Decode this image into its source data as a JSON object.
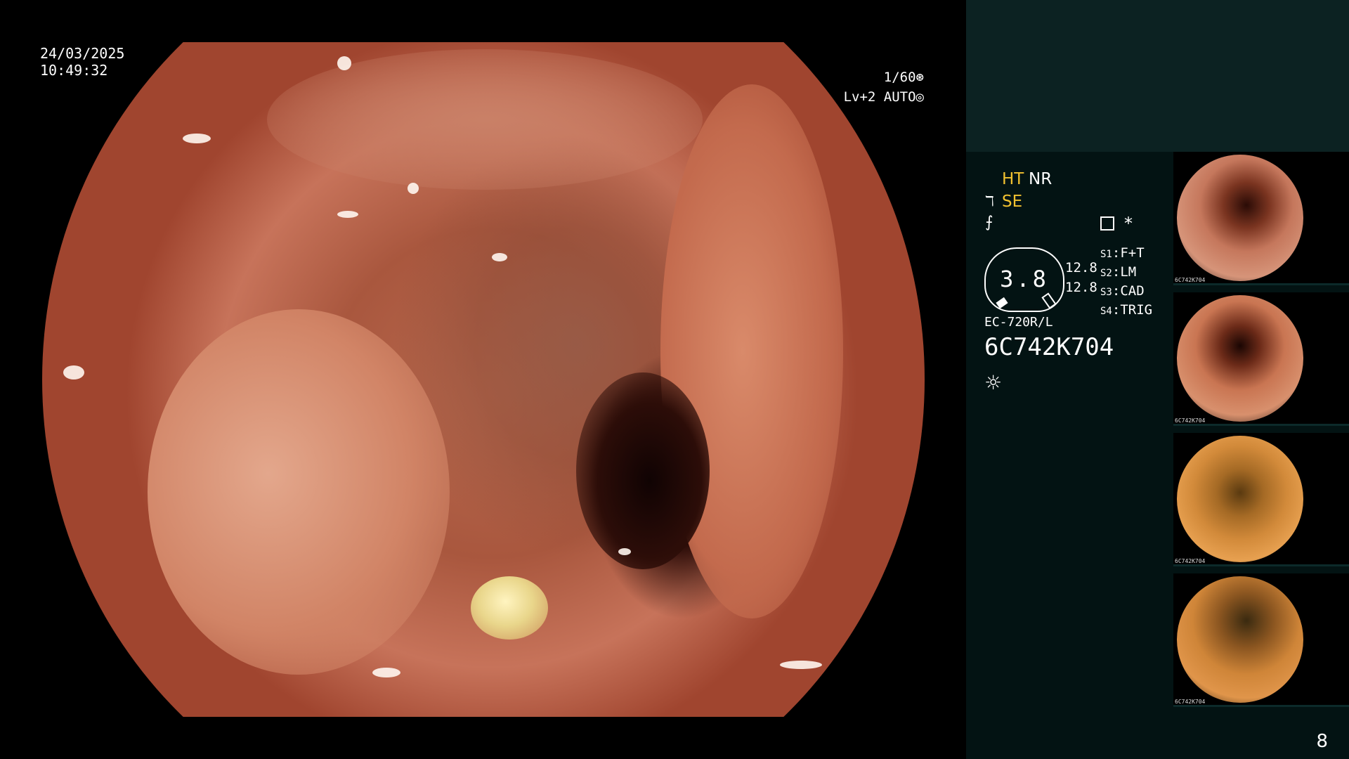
{
  "overlay": {
    "date": "24/03/2025",
    "time": "10:49:32",
    "shutter": "1/60",
    "shutter_icon": "aperture-icon",
    "level": "Lv+2",
    "mode": "AUTO",
    "mode_icon": "auto-exposure-icon"
  },
  "panel": {
    "ht": "HT",
    "nr": "NR",
    "se": "SE",
    "gauge_value": "3.8",
    "gauge_left": "12.8",
    "gauge_right": "12.8",
    "scope_model": "EC-720R/L",
    "serial": "6C742K704",
    "asterisk": "*",
    "switches": [
      {
        "key": "S1",
        "value": "F+T"
      },
      {
        "key": "S2",
        "value": "LM"
      },
      {
        "key": "S3",
        "value": "CAD"
      },
      {
        "key": "S4",
        "value": "TRIG"
      }
    ],
    "page_number": "8",
    "colors": {
      "accent_yellow": "#f2c230",
      "panel_bg": "#031313",
      "panel_top_bg": "#0c2222"
    }
  },
  "thumbnails": [
    {
      "label": "6C742K704"
    },
    {
      "label": "6C742K704"
    },
    {
      "label": "6C742K704"
    },
    {
      "label": "6C742K704"
    }
  ]
}
